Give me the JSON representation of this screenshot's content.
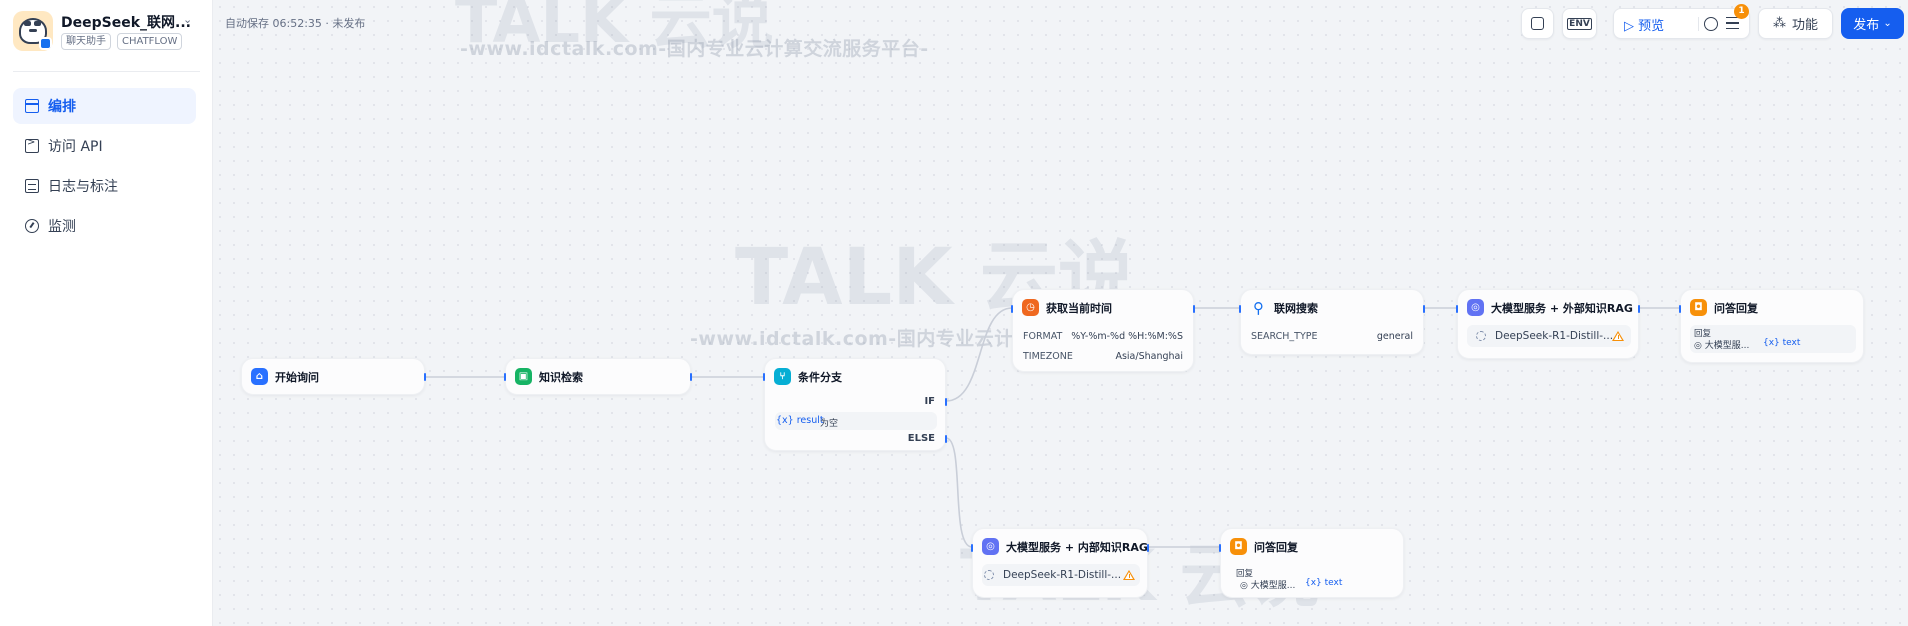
{
  "app": {
    "name": "DeepSeek_联网...",
    "tags": [
      "聊天助手",
      "CHATFLOW"
    ]
  },
  "nav": [
    {
      "label": "编排",
      "icon": "layout-icon",
      "active": true
    },
    {
      "label": "访问 API",
      "icon": "terminal-icon",
      "active": false
    },
    {
      "label": "日志与标注",
      "icon": "log-icon",
      "active": false
    },
    {
      "label": "监测",
      "icon": "gauge-icon",
      "active": false
    }
  ],
  "status": {
    "autosave": "自动保存 06:52:35 · 未发布"
  },
  "toolbar": {
    "env_label": "ENV",
    "preview": "预览",
    "notifications": "1",
    "features": "功能",
    "publish": "发布"
  },
  "watermark": {
    "logo": "TALK 云说",
    "sub": "-www.idctalk.com-国内专业云计算交流服务平台-"
  },
  "nodes": {
    "start": {
      "title": "开始询问"
    },
    "knowledge": {
      "title": "知识检索"
    },
    "ifelse": {
      "title": "条件分支",
      "if_label": "IF",
      "else_label": "ELSE",
      "cond_var": "{x}  result",
      "cond_op": "为空"
    },
    "time": {
      "title": "获取当前时间",
      "format_key": "FORMAT",
      "format_val": "%Y-%m-%d %H:%M:%S",
      "tz_key": "TIMEZONE",
      "tz_val": "Asia/Shanghai"
    },
    "search": {
      "title": "联网搜索",
      "key": "SEARCH_TYPE",
      "val": "general"
    },
    "llm_ext": {
      "title": "大模型服务 + 外部知识RAG",
      "model": "DeepSeek-R1-Distill-..."
    },
    "answer1": {
      "title": "问答回复",
      "label": "回复",
      "src": "大模型服...",
      "var": "{x} text"
    },
    "llm_int": {
      "title": "大模型服务 + 内部知识RAG",
      "model": "DeepSeek-R1-Distill-..."
    },
    "answer2": {
      "title": "问答回复",
      "label": "回复",
      "src": "大模型服...",
      "var": "{x} text"
    }
  },
  "colors": {
    "accent": "#155eef",
    "start": "#2970ff",
    "knowledge": "#16b364",
    "ifelse": "#06aed4",
    "time": "#ef6820",
    "llm": "#6172f3",
    "answer": "#f79009"
  }
}
